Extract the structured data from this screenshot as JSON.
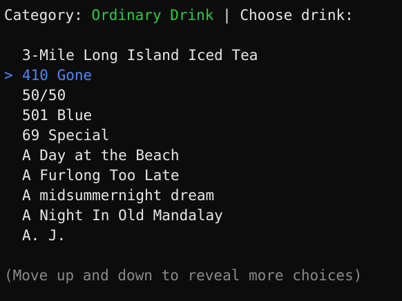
{
  "prompt": {
    "category_label": "Category: ",
    "category_value": "Ordinary Drink",
    "separator": " | ",
    "instruction": "Choose drink:"
  },
  "cursor_symbol": ">",
  "selected_index": 1,
  "choices": [
    "3-Mile Long Island Iced Tea",
    "410 Gone",
    "50/50",
    "501 Blue",
    "69 Special",
    "A Day at the Beach",
    "A Furlong Too Late",
    "A midsummernight dream",
    "A Night In Old Mandalay",
    "A. J."
  ],
  "help_text": "(Move up and down to reveal more choices)",
  "colors": {
    "background": "#0c0c0c",
    "text": "#e6e6e6",
    "accent_selected": "#4f86f7",
    "category_value": "#2ecc40",
    "help_text": "#8a8a8a"
  }
}
